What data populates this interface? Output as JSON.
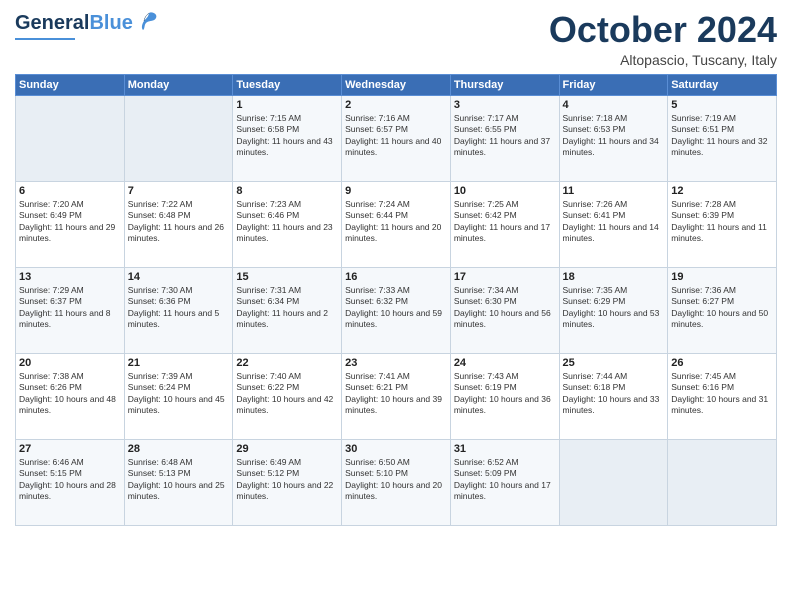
{
  "header": {
    "logo_general": "General",
    "logo_blue": "Blue",
    "month": "October 2024",
    "location": "Altopascio, Tuscany, Italy"
  },
  "days_of_week": [
    "Sunday",
    "Monday",
    "Tuesday",
    "Wednesday",
    "Thursday",
    "Friday",
    "Saturday"
  ],
  "weeks": [
    [
      {
        "day": "",
        "info": ""
      },
      {
        "day": "",
        "info": ""
      },
      {
        "day": "1",
        "info": "Sunrise: 7:15 AM\nSunset: 6:58 PM\nDaylight: 11 hours and 43 minutes."
      },
      {
        "day": "2",
        "info": "Sunrise: 7:16 AM\nSunset: 6:57 PM\nDaylight: 11 hours and 40 minutes."
      },
      {
        "day": "3",
        "info": "Sunrise: 7:17 AM\nSunset: 6:55 PM\nDaylight: 11 hours and 37 minutes."
      },
      {
        "day": "4",
        "info": "Sunrise: 7:18 AM\nSunset: 6:53 PM\nDaylight: 11 hours and 34 minutes."
      },
      {
        "day": "5",
        "info": "Sunrise: 7:19 AM\nSunset: 6:51 PM\nDaylight: 11 hours and 32 minutes."
      }
    ],
    [
      {
        "day": "6",
        "info": "Sunrise: 7:20 AM\nSunset: 6:49 PM\nDaylight: 11 hours and 29 minutes."
      },
      {
        "day": "7",
        "info": "Sunrise: 7:22 AM\nSunset: 6:48 PM\nDaylight: 11 hours and 26 minutes."
      },
      {
        "day": "8",
        "info": "Sunrise: 7:23 AM\nSunset: 6:46 PM\nDaylight: 11 hours and 23 minutes."
      },
      {
        "day": "9",
        "info": "Sunrise: 7:24 AM\nSunset: 6:44 PM\nDaylight: 11 hours and 20 minutes."
      },
      {
        "day": "10",
        "info": "Sunrise: 7:25 AM\nSunset: 6:42 PM\nDaylight: 11 hours and 17 minutes."
      },
      {
        "day": "11",
        "info": "Sunrise: 7:26 AM\nSunset: 6:41 PM\nDaylight: 11 hours and 14 minutes."
      },
      {
        "day": "12",
        "info": "Sunrise: 7:28 AM\nSunset: 6:39 PM\nDaylight: 11 hours and 11 minutes."
      }
    ],
    [
      {
        "day": "13",
        "info": "Sunrise: 7:29 AM\nSunset: 6:37 PM\nDaylight: 11 hours and 8 minutes."
      },
      {
        "day": "14",
        "info": "Sunrise: 7:30 AM\nSunset: 6:36 PM\nDaylight: 11 hours and 5 minutes."
      },
      {
        "day": "15",
        "info": "Sunrise: 7:31 AM\nSunset: 6:34 PM\nDaylight: 11 hours and 2 minutes."
      },
      {
        "day": "16",
        "info": "Sunrise: 7:33 AM\nSunset: 6:32 PM\nDaylight: 10 hours and 59 minutes."
      },
      {
        "day": "17",
        "info": "Sunrise: 7:34 AM\nSunset: 6:30 PM\nDaylight: 10 hours and 56 minutes."
      },
      {
        "day": "18",
        "info": "Sunrise: 7:35 AM\nSunset: 6:29 PM\nDaylight: 10 hours and 53 minutes."
      },
      {
        "day": "19",
        "info": "Sunrise: 7:36 AM\nSunset: 6:27 PM\nDaylight: 10 hours and 50 minutes."
      }
    ],
    [
      {
        "day": "20",
        "info": "Sunrise: 7:38 AM\nSunset: 6:26 PM\nDaylight: 10 hours and 48 minutes."
      },
      {
        "day": "21",
        "info": "Sunrise: 7:39 AM\nSunset: 6:24 PM\nDaylight: 10 hours and 45 minutes."
      },
      {
        "day": "22",
        "info": "Sunrise: 7:40 AM\nSunset: 6:22 PM\nDaylight: 10 hours and 42 minutes."
      },
      {
        "day": "23",
        "info": "Sunrise: 7:41 AM\nSunset: 6:21 PM\nDaylight: 10 hours and 39 minutes."
      },
      {
        "day": "24",
        "info": "Sunrise: 7:43 AM\nSunset: 6:19 PM\nDaylight: 10 hours and 36 minutes."
      },
      {
        "day": "25",
        "info": "Sunrise: 7:44 AM\nSunset: 6:18 PM\nDaylight: 10 hours and 33 minutes."
      },
      {
        "day": "26",
        "info": "Sunrise: 7:45 AM\nSunset: 6:16 PM\nDaylight: 10 hours and 31 minutes."
      }
    ],
    [
      {
        "day": "27",
        "info": "Sunrise: 6:46 AM\nSunset: 5:15 PM\nDaylight: 10 hours and 28 minutes."
      },
      {
        "day": "28",
        "info": "Sunrise: 6:48 AM\nSunset: 5:13 PM\nDaylight: 10 hours and 25 minutes."
      },
      {
        "day": "29",
        "info": "Sunrise: 6:49 AM\nSunset: 5:12 PM\nDaylight: 10 hours and 22 minutes."
      },
      {
        "day": "30",
        "info": "Sunrise: 6:50 AM\nSunset: 5:10 PM\nDaylight: 10 hours and 20 minutes."
      },
      {
        "day": "31",
        "info": "Sunrise: 6:52 AM\nSunset: 5:09 PM\nDaylight: 10 hours and 17 minutes."
      },
      {
        "day": "",
        "info": ""
      },
      {
        "day": "",
        "info": ""
      }
    ]
  ]
}
